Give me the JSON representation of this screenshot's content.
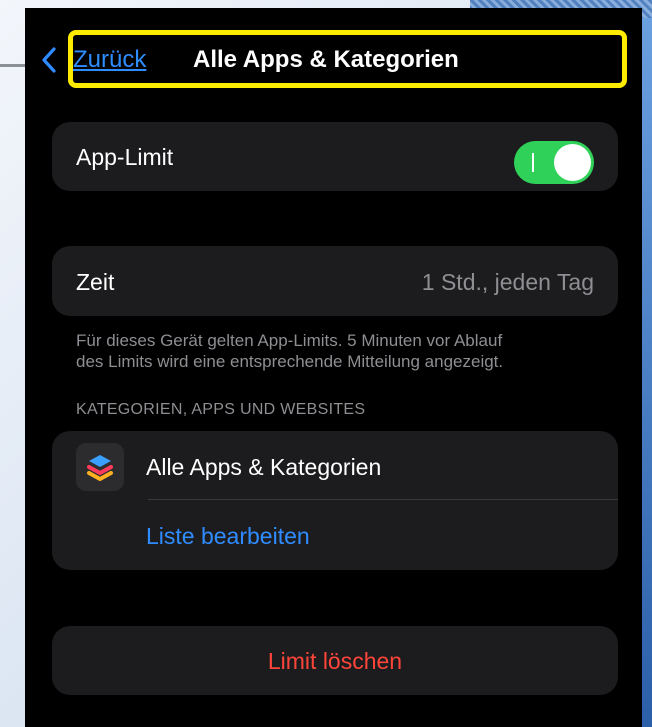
{
  "nav": {
    "back_label": "Zurück",
    "title": "Alle Apps & Kategorien"
  },
  "app_limit": {
    "label": "App-Limit",
    "toggle_on": true
  },
  "time": {
    "label": "Zeit",
    "value": "1 Std., jeden Tag"
  },
  "footnote": {
    "line1": "Für dieses Gerät gelten App-Limits. 5 Minuten vor Ablauf",
    "line2": "des Limits wird eine entsprechende Mitteilung angezeigt."
  },
  "section": {
    "header": "KATEGORIEN, APPS UND WEBSITES",
    "item_label": "Alle Apps & Kategorien",
    "edit_label": "Liste bearbeiten"
  },
  "delete": {
    "label": "Limit löschen"
  },
  "colors": {
    "accent_blue": "#2f8cff",
    "toggle_green": "#30d158",
    "destructive_red": "#ff453a",
    "highlight_yellow": "#ffeb00"
  }
}
